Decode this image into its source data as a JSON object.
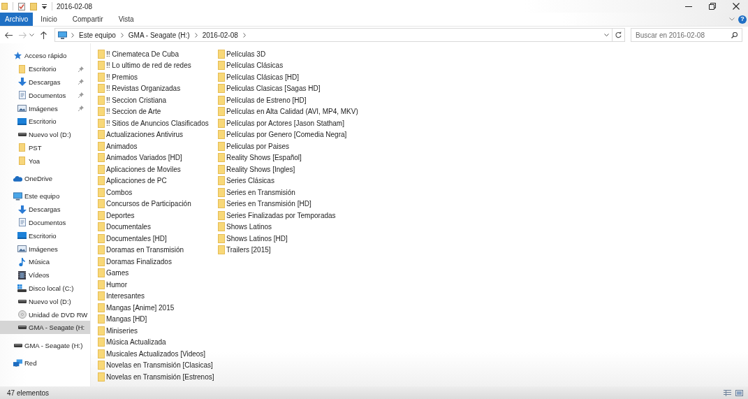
{
  "window": {
    "title": "2016-02-08"
  },
  "ribbon_tabs": [
    {
      "label": "Archivo",
      "kind": "file",
      "selected": false
    },
    {
      "label": "Inicio",
      "kind": "tab",
      "selected": false
    },
    {
      "label": "Compartir",
      "kind": "tab",
      "selected": false
    },
    {
      "label": "Vista",
      "kind": "tab",
      "selected": false
    }
  ],
  "help_button": {
    "label": "?"
  },
  "address_bar": {
    "segments": [
      "Este equipo",
      "GMA - Seagate (H:)",
      "2016-02-08"
    ]
  },
  "search": {
    "placeholder": "Buscar en 2016-02-08"
  },
  "navigation": {
    "items": [
      {
        "label": "Acceso rápido",
        "kind": "star",
        "selected": false,
        "children": [
          {
            "label": "Escritorio",
            "kind": "folder",
            "pinned": true,
            "selected": false
          },
          {
            "label": "Descargas",
            "kind": "downloads",
            "pinned": true,
            "selected": false
          },
          {
            "label": "Documentos",
            "kind": "documents",
            "pinned": true,
            "selected": false
          },
          {
            "label": "Imágenes",
            "kind": "pictures",
            "pinned": true,
            "selected": false
          },
          {
            "label": "Escritorio",
            "kind": "desktop",
            "pinned": false,
            "selected": false
          },
          {
            "label": "Nuevo vol (D:)",
            "kind": "drive",
            "pinned": false,
            "selected": false
          },
          {
            "label": "PST",
            "kind": "folder",
            "pinned": false,
            "selected": false
          },
          {
            "label": "Yoa",
            "kind": "folder",
            "pinned": false,
            "selected": false
          }
        ]
      },
      {
        "label": "OneDrive",
        "kind": "cloud",
        "selected": false
      },
      {
        "label": "Este equipo",
        "kind": "computer",
        "selected": false,
        "children": [
          {
            "label": "Descargas",
            "kind": "downloads",
            "selected": false
          },
          {
            "label": "Documentos",
            "kind": "documents",
            "selected": false
          },
          {
            "label": "Escritorio",
            "kind": "desktop",
            "selected": false
          },
          {
            "label": "Imágenes",
            "kind": "pictures",
            "selected": false
          },
          {
            "label": "Música",
            "kind": "music",
            "selected": false
          },
          {
            "label": "Vídeos",
            "kind": "videos",
            "selected": false
          },
          {
            "label": "Disco local (C:)",
            "kind": "system-drive",
            "selected": false
          },
          {
            "label": "Nuevo vol (D:)",
            "kind": "drive",
            "selected": false
          },
          {
            "label": "Unidad de DVD RW",
            "kind": "dvd",
            "selected": false
          },
          {
            "label": "GMA - Seagate (H:",
            "kind": "drive",
            "selected": true
          }
        ]
      },
      {
        "label": "GMA - Seagate (H:)",
        "kind": "drive",
        "selected": false
      },
      {
        "label": "Red",
        "kind": "network",
        "selected": false
      }
    ]
  },
  "folders": [
    "!! Cinemateca De Cuba",
    "!! Lo ultimo de red de redes",
    "!! Premios",
    "!! Revistas Organizadas",
    "!! Seccion Cristiana",
    "!! Seccion de Arte",
    "!! Sitios de Anuncios Clasificados",
    "Actualizaciones Antivirus",
    "Animados",
    "Animados Variados [HD]",
    "Aplicaciones de Moviles",
    "Aplicaciones de PC",
    "Combos",
    "Concursos de Participación",
    "Deportes",
    "Documentales",
    "Documentales [HD]",
    "Doramas en Transmisión",
    "Doramas Finalizados",
    "Games",
    "Humor",
    "Interesantes",
    "Mangas [Anime] 2015",
    "Mangas [HD]",
    "Miniseries",
    "Música Actualizada",
    "Musicales Actualizados [Videos]",
    "Novelas en Transmisión [Clasicas]",
    "Novelas en Transmisión [Estrenos]",
    "Películas 3D",
    "Películas Clásicas",
    "Películas Clásicas [HD]",
    "Peliculas Clasicas [Sagas HD]",
    "Películas de Estreno [HD]",
    "Películas en Alta Calidad (AVI, MP4, MKV)",
    "Películas por Actores [Jason Statham]",
    "Películas por Genero [Comedia Negra]",
    "Peliculas por Paises",
    "Reality Shows [Español]",
    "Reality Shows [Ingles]",
    "Series Clásicas",
    "Series en Transmisión",
    "Series en Transmisión [HD]",
    "Series Finalizadas por Temporadas",
    "Shows Latinos",
    "Shows Latinos [HD]",
    "Trailers [2015]"
  ],
  "status_bar": {
    "item_count": "47 elementos"
  }
}
